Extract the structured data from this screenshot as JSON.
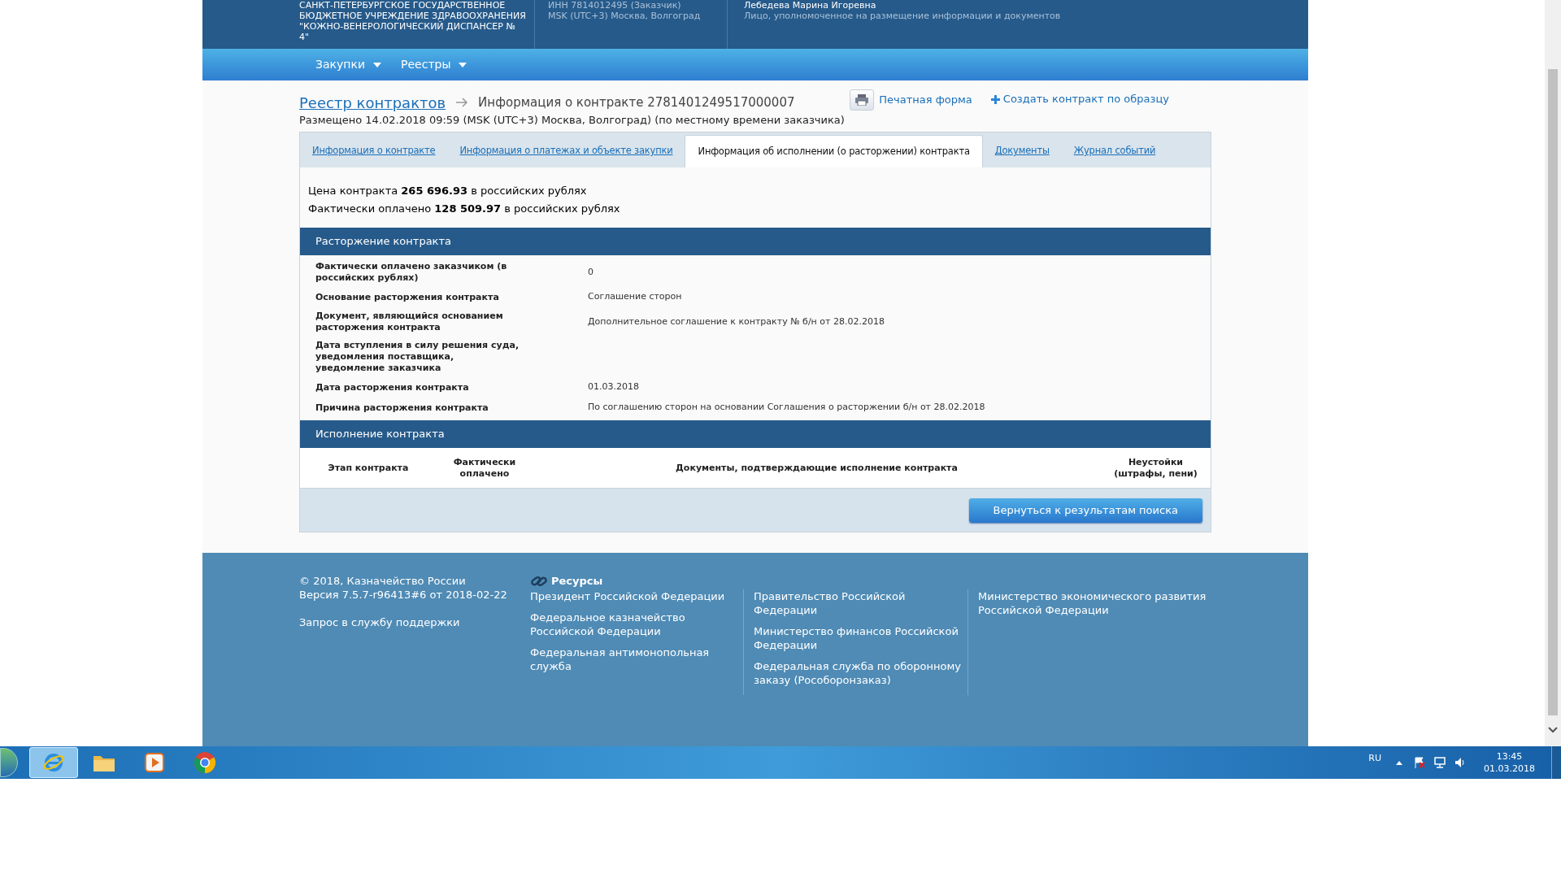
{
  "header": {
    "org_lines": [
      "САНКТ-ПЕТЕРБУРГСКОЕ ГОСУДАРСТВЕННОЕ",
      "БЮДЖЕТНОЕ УЧРЕЖДЕНИЕ ЗДРАВООХРАНЕНИЯ",
      "\"КОЖНО-ВЕНЕРОЛОГИЧЕСКИЙ ДИСПАНСЕР №",
      "4\""
    ],
    "inn": "ИНН 7814012495 (Заказчик)",
    "timezone": "MSK (UTC+3) Москва, Волгоград",
    "user_name": "Лебедева Марина Игоревна",
    "user_role": "Лицо, уполномоченное на размещение информации и документов"
  },
  "nav_menu": [
    {
      "label": "Закупки"
    },
    {
      "label": "Реестры"
    }
  ],
  "breadcrumb": {
    "link": "Реестр контрактов",
    "current": "Информация о контракте 2781401249517000007"
  },
  "actions": [
    {
      "kind": "print",
      "label": "Печатная форма"
    },
    {
      "kind": "create",
      "label": "Создать контракт по образцу"
    }
  ],
  "placed": "Размещено 14.02.2018 09:59 (MSK (UTC+3) Москва, Волгоград) (по местному времени заказчика)",
  "tabs": [
    {
      "label": "Информация о контракте",
      "selected": false
    },
    {
      "label": "Информация о платежах и объекте закупки",
      "selected": false
    },
    {
      "label": "Информация об исполнении (о расторжении) контракта",
      "selected": true
    },
    {
      "label": "Документы",
      "selected": false
    },
    {
      "label": "Журнал событий",
      "selected": false
    }
  ],
  "summary": [
    "Цена контракта **265 696.93** в российских рублях",
    "Фактически оплачено **128 509.97** в российских рублях"
  ],
  "termination": {
    "title": "Расторжение контракта",
    "rows": [
      {
        "label": "Фактически оплачено заказчиком (в российских рублях)",
        "value": "0"
      },
      {
        "label": "Основание расторжения контракта",
        "value": "Соглашение сторон"
      },
      {
        "label": "Документ, являющийся основанием расторжения контракта",
        "value": "Дополнительное соглашение к контракту № б/н от 28.02.2018"
      },
      {
        "label": "Дата вступления в силу решения суда, уведомления поставщика, уведомление заказчика"
      },
      {
        "label": "Дата расторжения контракта",
        "value": "01.03.2018"
      },
      {
        "label": "Причина расторжения контракта",
        "value": "По соглашению сторон на основании Соглашения о расторжении б/н от 28.02.2018"
      }
    ]
  },
  "execution": {
    "title": "Исполнение контракта",
    "columns": [
      "Этап контракта",
      "Фактически оплачено",
      "Документы, подтверждающие исполнение контракта",
      "Неустойки (штрафы, пени)"
    ]
  },
  "back_button": "Вернуться к результатам поиска",
  "footer": {
    "copyright": "© 2018, Казначейство России",
    "version": "Версия 7.5.7-r96413#6 от 2018-02-22",
    "support": "Запрос в службу поддержки",
    "resources_title": "Ресурсы",
    "resource_columns": [
      [
        "Президент Российской Федерации",
        "Федеральное казначейство Российской Федерации",
        "Федеральная антимонопольная служба"
      ],
      [
        "Правительство Российской Федерации",
        "Министерство финансов Российской Федерации",
        "Федеральная служба по оборонному заказу (Рособоронзаказ)"
      ],
      [
        "Министерство экономического развития Российской Федерации"
      ]
    ]
  },
  "taskbar": {
    "apps": [
      {
        "kind": "ie",
        "selected": true
      },
      {
        "kind": "folder",
        "selected": false
      },
      {
        "kind": "media",
        "selected": false
      },
      {
        "kind": "chrome",
        "selected": false
      }
    ],
    "language": "RU",
    "time": "13:45",
    "date": "01.03.2018"
  }
}
